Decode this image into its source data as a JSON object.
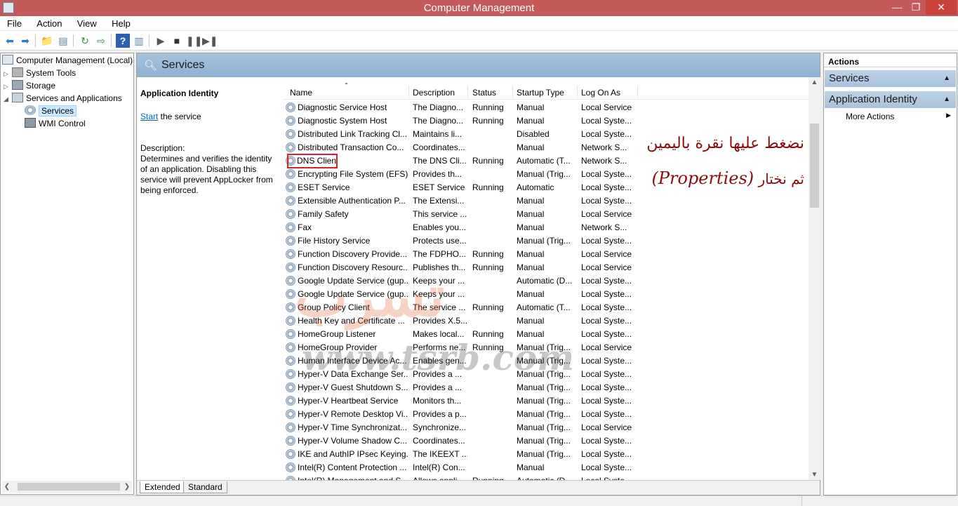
{
  "window": {
    "title": "Computer Management",
    "minimize_glyph": "—",
    "restore_glyph": "❐",
    "close_glyph": "✕"
  },
  "menu": [
    "File",
    "Action",
    "View",
    "Help"
  ],
  "tree": {
    "root": "Computer Management (Local)",
    "items": [
      {
        "label": "System Tools",
        "icon": "system-tools-icon"
      },
      {
        "label": "Storage",
        "icon": "storage-icon"
      },
      {
        "label": "Services and Applications",
        "icon": "services-apps-icon"
      },
      {
        "label": "Services",
        "icon": "services-icon"
      },
      {
        "label": "WMI Control",
        "icon": "wmi-icon"
      }
    ]
  },
  "services_panel": {
    "header": "Services",
    "selected_name": "Application Identity",
    "start_link": "Start",
    "start_suffix": " the service",
    "description_label": "Description:",
    "description": "Determines and verifies the identity of an application. Disabling this service will prevent AppLocker from being enforced."
  },
  "columns": [
    "Name",
    "Description",
    "Status",
    "Startup Type",
    "Log On As"
  ],
  "services": [
    [
      "Diagnostic Service Host",
      "The Diagno...",
      "Running",
      "Manual",
      "Local Service"
    ],
    [
      "Diagnostic System Host",
      "The Diagno...",
      "Running",
      "Manual",
      "Local Syste..."
    ],
    [
      "Distributed Link Tracking Cl...",
      "Maintains li...",
      "",
      "Disabled",
      "Local Syste..."
    ],
    [
      "Distributed Transaction Co...",
      "Coordinates...",
      "",
      "Manual",
      "Network S..."
    ],
    [
      "DNS Client",
      "The DNS Cli...",
      "Running",
      "Automatic (T...",
      "Network S..."
    ],
    [
      "Encrypting File System (EFS)",
      "Provides th...",
      "",
      "Manual (Trig...",
      "Local Syste..."
    ],
    [
      "ESET Service",
      "ESET Service",
      "Running",
      "Automatic",
      "Local Syste..."
    ],
    [
      "Extensible Authentication P...",
      "The Extensi...",
      "",
      "Manual",
      "Local Syste..."
    ],
    [
      "Family Safety",
      "This service ...",
      "",
      "Manual",
      "Local Service"
    ],
    [
      "Fax",
      "Enables you...",
      "",
      "Manual",
      "Network S..."
    ],
    [
      "File History Service",
      "Protects use...",
      "",
      "Manual (Trig...",
      "Local Syste..."
    ],
    [
      "Function Discovery Provide...",
      "The FDPHO...",
      "Running",
      "Manual",
      "Local Service"
    ],
    [
      "Function Discovery Resourc...",
      "Publishes th...",
      "Running",
      "Manual",
      "Local Service"
    ],
    [
      "Google Update Service (gup...",
      "Keeps your ...",
      "",
      "Automatic (D...",
      "Local Syste..."
    ],
    [
      "Google Update Service (gup...",
      "Keeps your ...",
      "",
      "Manual",
      "Local Syste..."
    ],
    [
      "Group Policy Client",
      "The service ...",
      "Running",
      "Automatic (T...",
      "Local Syste..."
    ],
    [
      "Health Key and Certificate ...",
      "Provides X.5...",
      "",
      "Manual",
      "Local Syste..."
    ],
    [
      "HomeGroup Listener",
      "Makes local...",
      "Running",
      "Manual",
      "Local Syste..."
    ],
    [
      "HomeGroup Provider",
      "Performs ne...",
      "Running",
      "Manual (Trig...",
      "Local Service"
    ],
    [
      "Human Interface Device Ac...",
      "Enables gen...",
      "",
      "Manual (Trig...",
      "Local Syste..."
    ],
    [
      "Hyper-V Data Exchange Ser...",
      "Provides a ...",
      "",
      "Manual (Trig...",
      "Local Syste..."
    ],
    [
      "Hyper-V Guest Shutdown S...",
      "Provides a ...",
      "",
      "Manual (Trig...",
      "Local Syste..."
    ],
    [
      "Hyper-V Heartbeat Service",
      "Monitors th...",
      "",
      "Manual (Trig...",
      "Local Syste..."
    ],
    [
      "Hyper-V Remote Desktop Vi...",
      "Provides a p...",
      "",
      "Manual (Trig...",
      "Local Syste..."
    ],
    [
      "Hyper-V Time Synchronizat...",
      "Synchronize...",
      "",
      "Manual (Trig...",
      "Local Service"
    ],
    [
      "Hyper-V Volume Shadow C...",
      "Coordinates...",
      "",
      "Manual (Trig...",
      "Local Syste..."
    ],
    [
      "IKE and AuthIP IPsec Keying...",
      "The IKEEXT ...",
      "",
      "Manual (Trig...",
      "Local Syste..."
    ],
    [
      "Intel(R) Content Protection ...",
      "Intel(R) Con...",
      "",
      "Manual",
      "Local Syste..."
    ],
    [
      "Intel(R) Management and S...",
      "Allows appli...",
      "Running",
      "Automatic (D...",
      "Local Syste..."
    ]
  ],
  "highlighted_service": "DNS Client",
  "tabs": [
    "Extended",
    "Standard"
  ],
  "actions": {
    "header": "Actions",
    "sections": [
      "Services",
      "Application Identity"
    ],
    "more": "More Actions"
  },
  "annotation": {
    "line1": "نضغط عليها نقرة باليمين",
    "line2_prefix": "ثم نختار",
    "line2_en": "(Properties)"
  },
  "watermark": {
    "brand": "تسرب",
    "url": "www.tsrb.com"
  },
  "colors": {
    "titlebar": "#c55a5a",
    "header_blue": "#8fb0d2",
    "highlight_box": "#d2232a",
    "annotation": "#8b0c10"
  }
}
